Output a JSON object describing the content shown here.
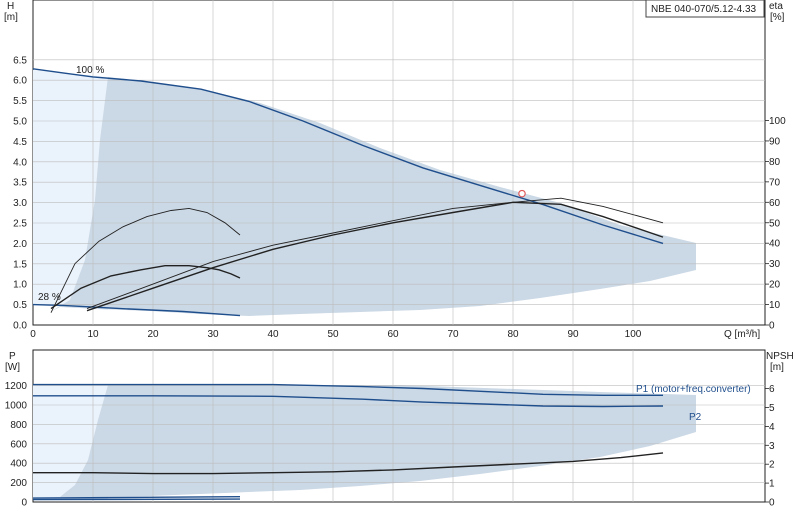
{
  "chart_data": [
    {
      "type": "line",
      "title": "NBE 040-070/5.12-4.33",
      "y_label": "H",
      "y_unit": "[m]",
      "y2_label": "eta",
      "y2_unit": "[%]",
      "x_label": "Q [m³/h]",
      "xlim": [
        0,
        110
      ],
      "ylim": [
        0,
        7.5
      ],
      "y2lim": [
        0,
        110
      ],
      "x_ticks": [
        0,
        10,
        20,
        30,
        40,
        50,
        60,
        70,
        80,
        90,
        100
      ],
      "y_ticks": [
        0.0,
        0.5,
        1.0,
        1.5,
        2.0,
        2.5,
        3.0,
        3.5,
        4.0,
        4.5,
        5.0,
        5.5,
        6.0,
        6.5
      ],
      "y2_ticks": [
        0,
        10,
        20,
        30,
        40,
        50,
        60,
        70,
        80,
        90,
        100
      ],
      "grid": true,
      "annotations": [
        "100 %",
        "28 %"
      ],
      "duty_point": {
        "x": 81.5,
        "y": 3.22
      },
      "series": [
        {
          "kind": "head-max",
          "axis": "y",
          "color": "#1f4e8c",
          "x": [
            0,
            5,
            10,
            18,
            28,
            36,
            45,
            55,
            65,
            75,
            85,
            95,
            105
          ],
          "y": [
            6.28,
            6.18,
            6.08,
            5.98,
            5.78,
            5.48,
            5.0,
            4.4,
            3.85,
            3.4,
            2.95,
            2.45,
            2.0
          ]
        },
        {
          "kind": "head-min",
          "axis": "y",
          "color": "#1f4e8c",
          "x": [
            0,
            5,
            15,
            25,
            34.5
          ],
          "y": [
            0.5,
            0.48,
            0.4,
            0.33,
            0.23
          ]
        },
        {
          "kind": "eta-max",
          "axis": "y2",
          "color": "#222222",
          "x": [
            9,
            20,
            30,
            40,
            50,
            60,
            70,
            80,
            88,
            95,
            105
          ],
          "y": [
            7,
            18,
            28,
            37,
            44,
            50,
            55,
            60,
            59,
            53,
            43
          ]
        },
        {
          "kind": "eta-max-thin",
          "axis": "y2",
          "color": "#222222",
          "x": [
            9,
            20,
            30,
            40,
            50,
            60,
            70,
            80,
            88,
            95,
            105
          ],
          "y": [
            8,
            20,
            31,
            39,
            45,
            51,
            57,
            60,
            62,
            58,
            50
          ]
        },
        {
          "kind": "eta-min",
          "axis": "y2",
          "color": "#222222",
          "x": [
            3,
            8,
            13,
            18,
            22,
            26,
            29,
            31,
            33,
            34.5
          ],
          "y": [
            8,
            18,
            24,
            27,
            29,
            29,
            28,
            27,
            25,
            23
          ]
        },
        {
          "kind": "eta-min-thin",
          "axis": "y2",
          "color": "#222222",
          "x": [
            3,
            7,
            11,
            15,
            19,
            23,
            26,
            29,
            32,
            34.5
          ],
          "y": [
            6,
            30,
            41,
            48,
            53,
            56,
            57,
            55,
            50,
            44
          ]
        }
      ]
    },
    {
      "type": "line",
      "y_label": "P",
      "y_unit": "[W]",
      "y2_label": "NPSH",
      "y2_unit": "[m]",
      "xlim": [
        0,
        110
      ],
      "ylim": [
        0,
        1400
      ],
      "y2lim": [
        0,
        7.3
      ],
      "y_ticks": [
        0,
        200,
        400,
        600,
        800,
        1000,
        1200
      ],
      "y2_ticks": [
        0,
        1,
        2,
        3,
        4,
        5,
        6
      ],
      "grid": true,
      "series": [
        {
          "name": "P1 (motor+freq.converter)",
          "axis": "y",
          "color": "#1f4e8c",
          "x": [
            0,
            20,
            40,
            55,
            65,
            75,
            85,
            95,
            105
          ],
          "y": [
            1210,
            1210,
            1210,
            1190,
            1170,
            1140,
            1110,
            1100,
            1100
          ]
        },
        {
          "name": "P2",
          "axis": "y",
          "color": "#1f4e8c",
          "x": [
            0,
            20,
            40,
            55,
            65,
            75,
            85,
            95,
            105
          ],
          "y": [
            1095,
            1095,
            1090,
            1060,
            1030,
            1010,
            990,
            985,
            990
          ]
        },
        {
          "kind": "npsh",
          "axis": "y2",
          "color": "#222222",
          "x": [
            0,
            10,
            20,
            30,
            40,
            50,
            60,
            70,
            80,
            90,
            98,
            105
          ],
          "y": [
            1.55,
            1.55,
            1.5,
            1.5,
            1.55,
            1.6,
            1.7,
            1.85,
            2.0,
            2.15,
            2.35,
            2.6
          ]
        },
        {
          "kind": "p-min-a",
          "axis": "y",
          "color": "#1f4e8c",
          "x": [
            0,
            34.5
          ],
          "y": [
            40,
            55
          ]
        },
        {
          "kind": "p-min-b",
          "axis": "y",
          "color": "#1f4e8c",
          "x": [
            0,
            34.5
          ],
          "y": [
            25,
            30
          ]
        }
      ]
    }
  ]
}
